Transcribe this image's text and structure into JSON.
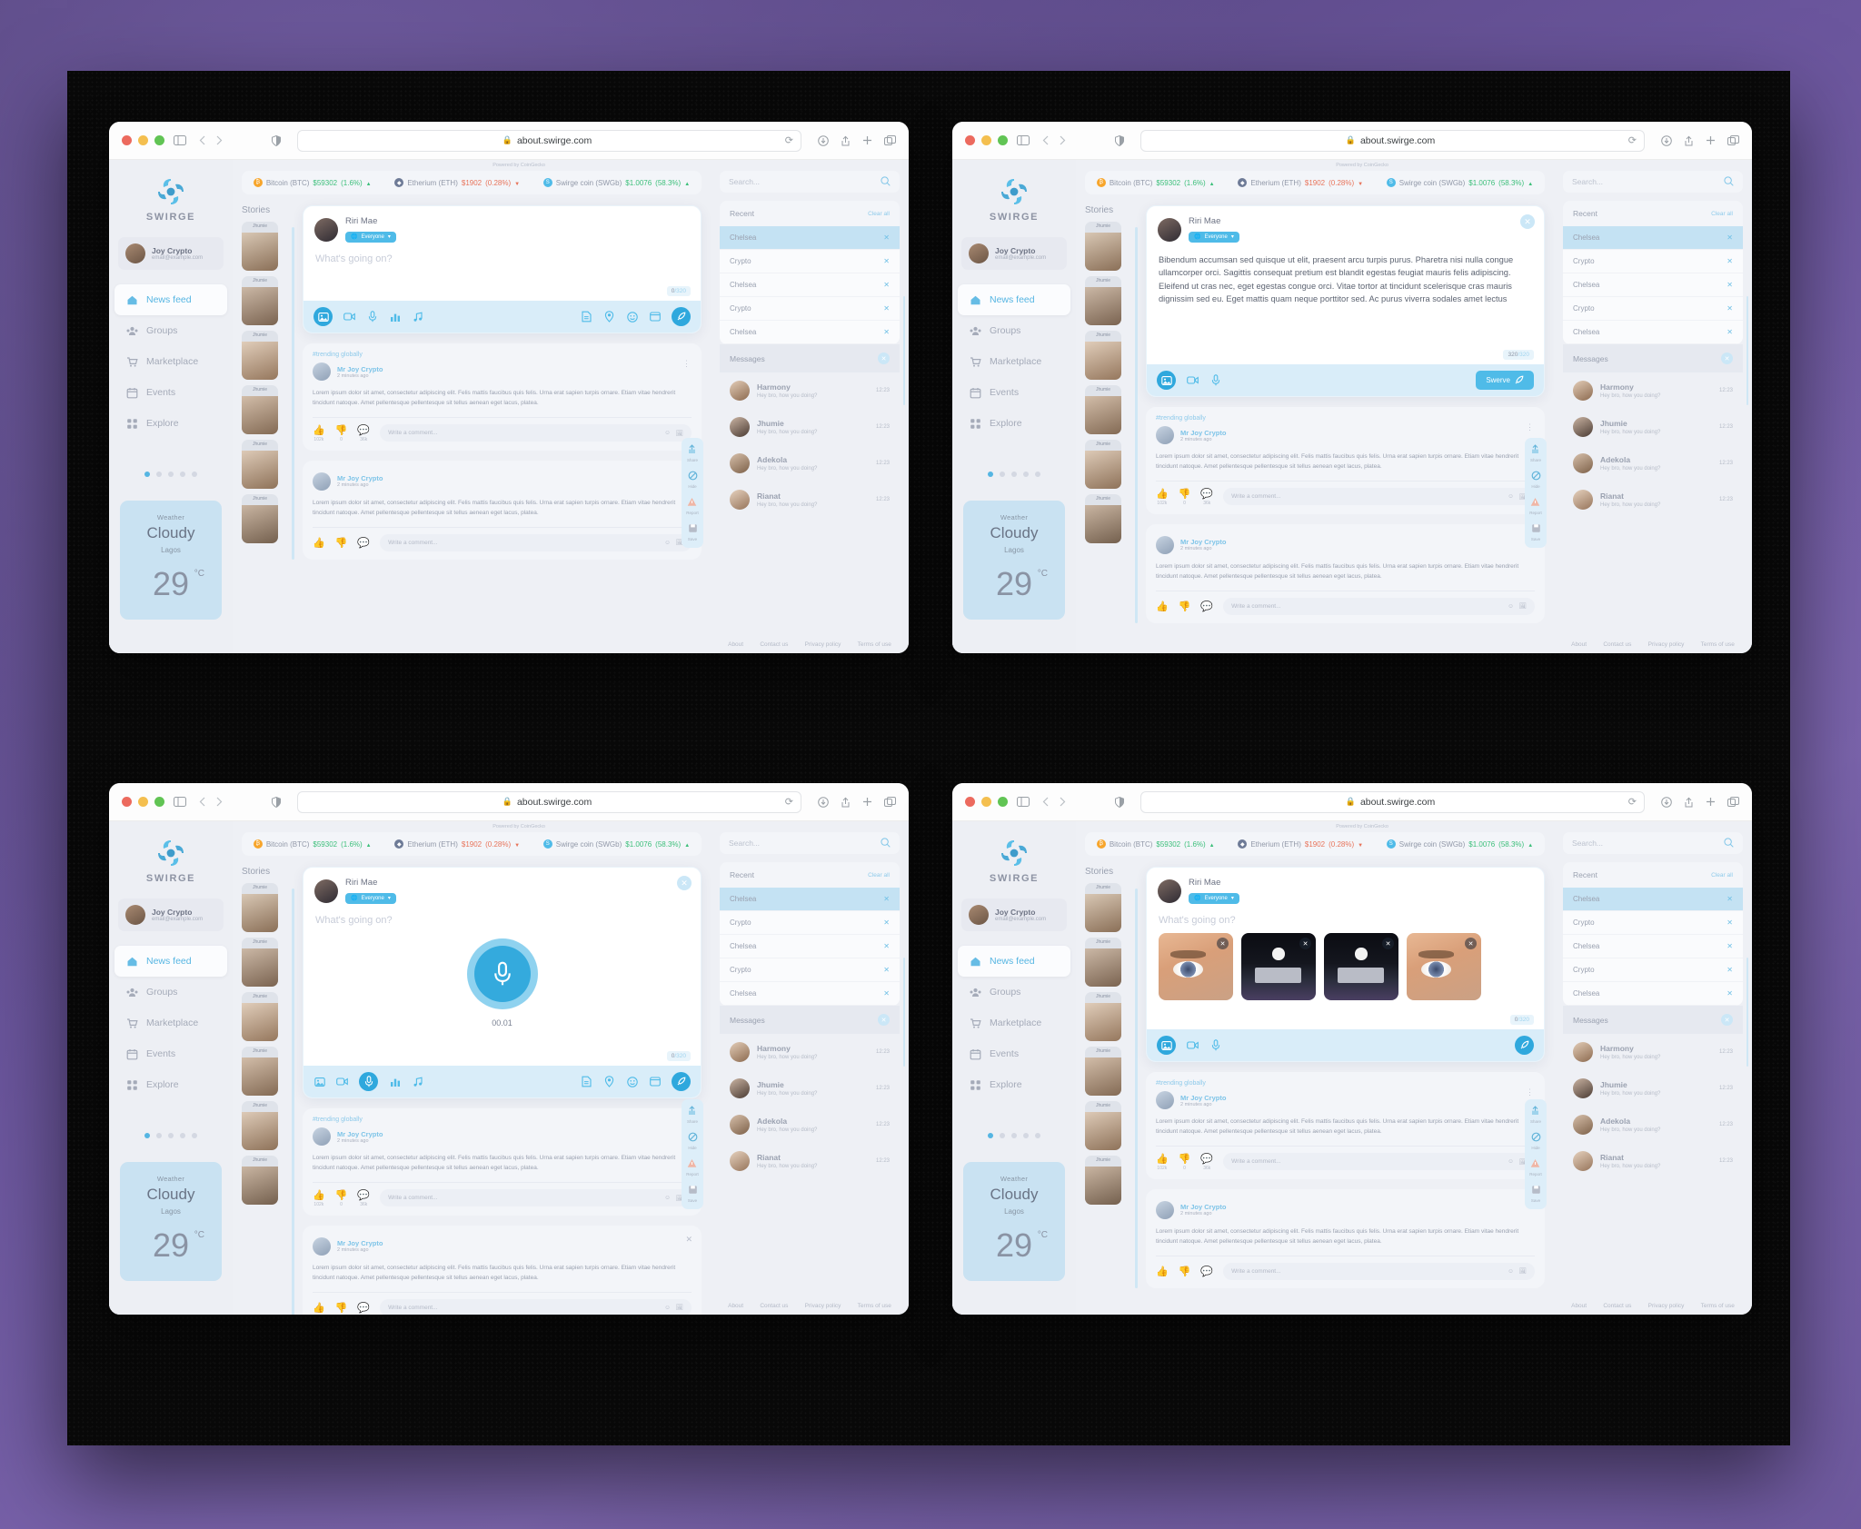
{
  "browser": {
    "url": "about.swirge.com",
    "lock_icon": "lock-icon",
    "reload_icon": "reload-icon",
    "sidebar_icon": "sidebar-toggle-icon",
    "back_icon": "back-arrow-icon",
    "forward_icon": "forward-arrow-icon",
    "shield_icon": "privacy-shield-icon",
    "download_icon": "downloads-icon",
    "share_icon": "share-icon",
    "newtab_icon": "new-tab-icon",
    "tabs_icon": "show-tabs-icon"
  },
  "brand": {
    "name": "SWIRGE",
    "logo_icon": "swirge-logo-icon"
  },
  "profile": {
    "name": "Joy Crypto",
    "email": "email@example.com",
    "avatar_icon": "user-avatar"
  },
  "nav": {
    "items": [
      {
        "label": "News feed",
        "icon": "home-icon",
        "active": true
      },
      {
        "label": "Groups",
        "icon": "groups-icon",
        "active": false
      },
      {
        "label": "Marketplace",
        "icon": "marketplace-icon",
        "active": false
      },
      {
        "label": "Events",
        "icon": "calendar-icon",
        "active": false
      },
      {
        "label": "Explore",
        "icon": "grid-icon",
        "active": false
      }
    ],
    "pager_dots": 5,
    "pager_active": 0
  },
  "weather": {
    "label": "Weather",
    "condition": "Cloudy",
    "city": "Lagos",
    "temp": "29",
    "unit": "°C"
  },
  "ticker": {
    "powered_by": "Powered by CoinGecko",
    "coins": [
      {
        "name": "Bitcoin (BTC)",
        "price": "$59302",
        "change": "(1.6%)",
        "dir": "up",
        "sym": "₿",
        "color": "#f7a52b"
      },
      {
        "name": "Etherium (ETH)",
        "price": "$1902",
        "change": "(0.28%)",
        "dir": "down",
        "sym": "◆",
        "color": "#6e7b97"
      },
      {
        "name": "Swirge coin (SWGb)",
        "price": "$1.0076",
        "change": "(58.3%)",
        "dir": "up",
        "sym": "S",
        "color": "#4fbbe8"
      }
    ]
  },
  "stories": {
    "title": "Stories",
    "items": [
      {
        "name": "Jhumie"
      },
      {
        "name": "Jhumie"
      },
      {
        "name": "Jhumie"
      },
      {
        "name": "Jhumie"
      },
      {
        "name": "Jhumie"
      },
      {
        "name": "Jhumie"
      }
    ]
  },
  "composer": {
    "author": "Riri Mae",
    "audience": "Everyone",
    "audience_icon": "globe-icon",
    "chevron_icon": "chevron-down-icon",
    "placeholder": "What's going on?",
    "counter_empty_used": "0",
    "counter_empty_total": "/320",
    "counter_full_used": "320",
    "counter_full_total": "/320",
    "text": "Bibendum accumsan sed quisque ut elit, praesent arcu turpis purus. Pharetra nisi nulla congue ullamcorper orci. Sagittis consequat pretium est blandit egestas feugiat mauris felis adipiscing. Eleifend ut cras nec, eget egestas congue orci. Vitae tortor at tincidunt scelerisque cras mauris dignissim sed eu. Eget mattis quam neque porttitor sed. Ac purus viverra sodales amet lectus",
    "submit_label": "Swerve",
    "submit_icon": "rocket-icon",
    "close_icon": "close-icon",
    "left_icons": [
      "image-icon",
      "video-icon",
      "mic-icon",
      "poll-icon",
      "music-icon"
    ],
    "right_icons": [
      "document-icon",
      "location-icon",
      "emoji-icon",
      "gif-icon"
    ],
    "timer": "00.01",
    "media_icons": [
      "close-icon",
      "close-icon",
      "close-icon",
      "close-icon"
    ]
  },
  "post": {
    "trending": "#trending globally",
    "author": "Mr Joy Crypto",
    "time": "2 minutes ago",
    "text": "Lorem ipsum dolor sit amet, consectetur adipiscing elit. Felis mattis faucibus quis felis. Urna erat sapien turpis ornare. Etiam vitae hendrerit tincidunt natoque. Amet pellentesque pellentesque sit tellus aenean eget lacus, platea.",
    "like_count": "102k",
    "dislike_count": "0",
    "comment_count": "36k",
    "like_icon": "thumbs-up-icon",
    "dislike_icon": "thumbs-down-icon",
    "comment_icon": "comment-icon",
    "comment_placeholder": "Write a comment...",
    "emoji_icon": "emoji-icon",
    "attach_icon": "attach-image-icon",
    "kebab_icon": "more-options-icon",
    "close_icon": "close-icon"
  },
  "strip": {
    "items": [
      {
        "label": "Share",
        "icon": "share-icon"
      },
      {
        "label": "Hide",
        "icon": "hide-icon"
      },
      {
        "label": "Report",
        "icon": "report-icon"
      },
      {
        "label": "Save",
        "icon": "save-icon"
      }
    ]
  },
  "right": {
    "search_placeholder": "Search...",
    "search_icon": "search-icon",
    "recent_title": "Recent",
    "clear_all": "Clear all",
    "recent_items": [
      {
        "label": "Chelsea",
        "selected": true
      },
      {
        "label": "Crypto",
        "selected": false
      },
      {
        "label": "Chelsea",
        "selected": false
      },
      {
        "label": "Crypto",
        "selected": false
      },
      {
        "label": "Chelsea",
        "selected": false
      }
    ],
    "remove_icon": "close-icon",
    "messages_title": "Messages",
    "messages_close_icon": "close-icon",
    "messages": [
      {
        "name": "Harmony",
        "preview": "Hey bro, how you doing?",
        "time": "12:23"
      },
      {
        "name": "Jhumie",
        "preview": "Hey bro, how you doing?",
        "time": "12:23"
      },
      {
        "name": "Adekola",
        "preview": "Hey bro, how you doing?",
        "time": "12:23"
      },
      {
        "name": "Rianat",
        "preview": "Hey bro, how you doing?",
        "time": "12:23"
      }
    ]
  },
  "footer": {
    "links": [
      "About",
      "Contact us",
      "Privacy policy",
      "Terms of use"
    ]
  },
  "colors": {
    "accent": "#4fbbe8",
    "accent_dark": "#2fa8dd",
    "up": "#3cbf7a",
    "down": "#e8745b",
    "weather_bg": "#c9e2f2"
  }
}
